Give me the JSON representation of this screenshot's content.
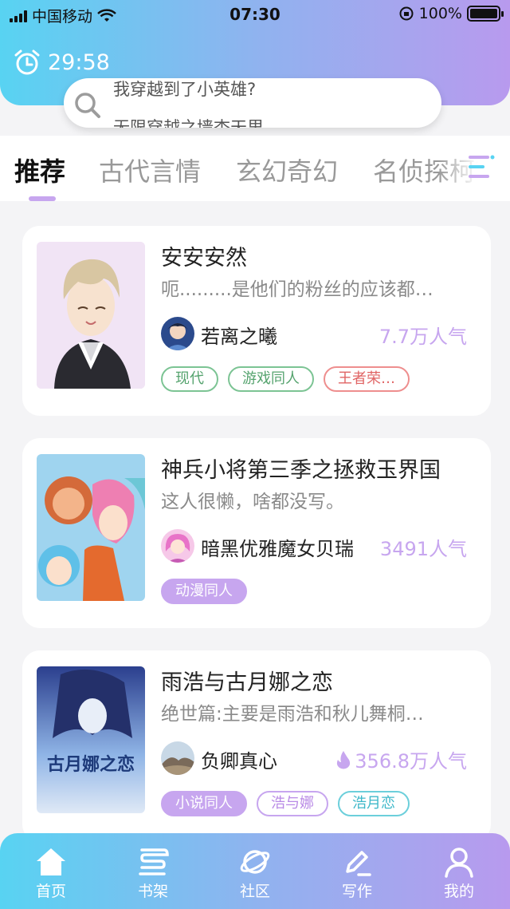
{
  "status": {
    "carrier": "中国移动",
    "time": "07:30",
    "battery": "100%"
  },
  "timer": {
    "value": "29:58"
  },
  "search": {
    "line1": "我穿越到了小英雄?",
    "line2": "无限穿越之墙杏天里"
  },
  "tabs": [
    {
      "label": "推荐"
    },
    {
      "label": "古代言情"
    },
    {
      "label": "玄幻奇幻"
    },
    {
      "label": "名侦探柯南"
    }
  ],
  "cards": [
    {
      "title": "安安安然",
      "desc": "呃.........是他们的粉丝的应该都…",
      "author": "若离之曦",
      "popularity": "7.7万人气",
      "tags": [
        "现代",
        "游戏同人",
        "王者荣…"
      ]
    },
    {
      "title": "神兵小将第三季之拯救玉界国",
      "desc": "这人很懒，啥都没写。",
      "author": "暗黑优雅魔女贝瑞",
      "popularity": "3491人气",
      "tags": [
        "动漫同人"
      ]
    },
    {
      "title": "雨浩与古月娜之恋",
      "desc": "绝世篇:主要是雨浩和秋儿舞桐…",
      "author": "负卿真心",
      "popularity": "356.8万人气",
      "tags": [
        "小说同人",
        "浩与娜",
        "浩月恋"
      ],
      "cover_text": "古月娜之恋"
    }
  ],
  "nav": [
    {
      "label": "首页",
      "icon": "home-icon"
    },
    {
      "label": "书架",
      "icon": "bookshelf-icon"
    },
    {
      "label": "社区",
      "icon": "planet-icon"
    },
    {
      "label": "写作",
      "icon": "pen-icon"
    },
    {
      "label": "我的",
      "icon": "user-icon"
    }
  ],
  "colors": {
    "accent": "#c7a6ef",
    "gradient_start": "#58d3f2",
    "gradient_end": "#b89aee"
  }
}
